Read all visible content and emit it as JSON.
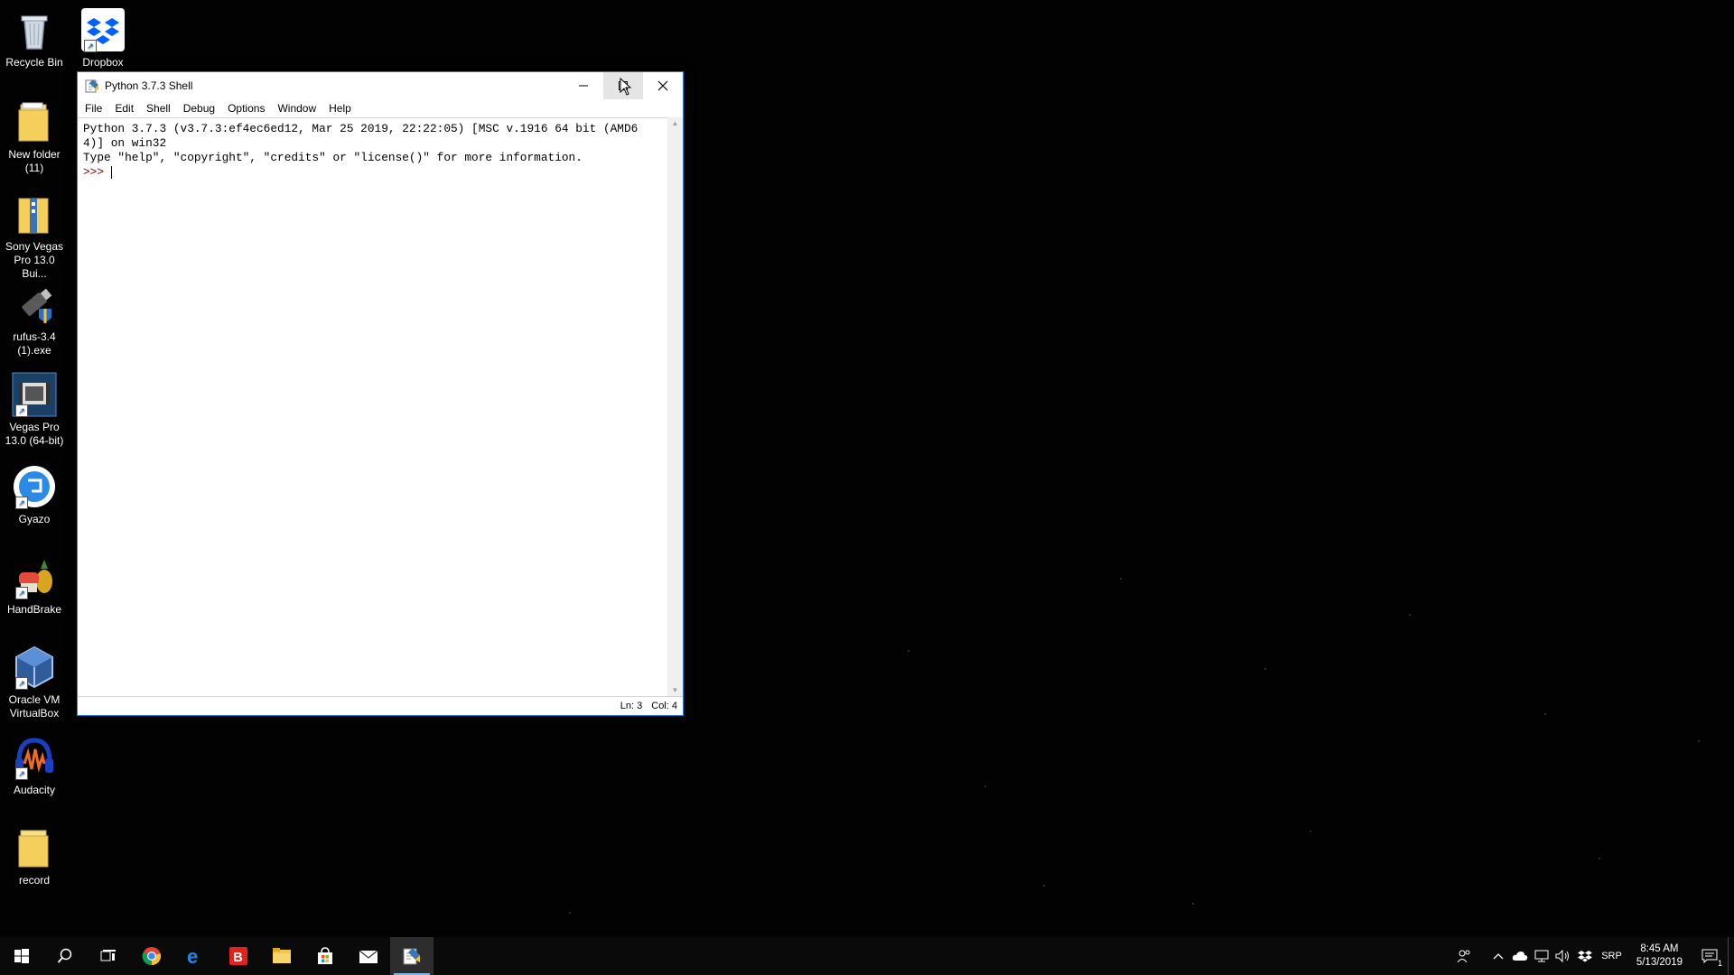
{
  "desktop": {
    "icons": [
      {
        "label": "Recycle Bin",
        "icon": "recycle-bin-icon"
      },
      {
        "label": "Dropbox",
        "icon": "dropbox-icon"
      },
      {
        "label": "New folder (11)",
        "icon": "folder-icon"
      },
      {
        "label": "Sony Vegas Pro 13.0 Bui...",
        "icon": "folder-zip-icon"
      },
      {
        "label": "rufus-3.4 (1).exe",
        "icon": "usb-drive-icon"
      },
      {
        "label": "Vegas Pro 13.0 (64-bit)",
        "icon": "film-icon"
      },
      {
        "label": "Gyazo",
        "icon": "gyazo-icon"
      },
      {
        "label": "HandBrake",
        "icon": "handbrake-icon"
      },
      {
        "label": "Oracle VM VirtualBox",
        "icon": "virtualbox-icon"
      },
      {
        "label": "Audacity",
        "icon": "audacity-icon"
      },
      {
        "label": "record",
        "icon": "folder-icon"
      }
    ]
  },
  "window": {
    "title": "Python 3.7.3 Shell",
    "menu": [
      "File",
      "Edit",
      "Shell",
      "Debug",
      "Options",
      "Window",
      "Help"
    ],
    "shell_lines": [
      "Python 3.7.3 (v3.7.3:ef4ec6ed12, Mar 25 2019, 22:22:05) [MSC v.1916 64 bit (AMD6",
      "4)] on win32",
      "Type \"help\", \"copyright\", \"credits\" or \"license()\" for more information."
    ],
    "prompt": ">>> ",
    "status": {
      "line": "Ln: 3",
      "col": "Col: 4"
    }
  },
  "taskbar": {
    "apps": [
      "start-icon",
      "search-icon",
      "task-view-icon",
      "chrome-icon",
      "edge-icon",
      "bitdefender-icon",
      "file-explorer-icon",
      "store-icon",
      "mail-icon",
      "idle-icon"
    ],
    "language": "SRP",
    "time": "8:45 AM",
    "date": "5/13/2019",
    "notification_count": "1"
  },
  "colors": {
    "accent": "#1883d7",
    "taskbar": "#0a0a0a",
    "desktop": "#020202"
  }
}
